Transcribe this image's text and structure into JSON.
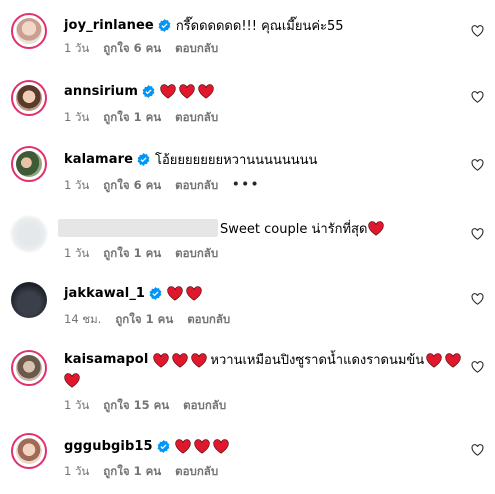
{
  "comments": [
    {
      "username": "joy_rinlanee",
      "verified": true,
      "text": "กรี๊ดดดดดด!!! คุณเมี๊ยนค่ะ55",
      "time": "1 วัน",
      "likes": "ถูกใจ 6 คน",
      "reply": "ตอบกลับ"
    },
    {
      "username": "annsirium",
      "verified": true,
      "text": "",
      "time": "1 วัน",
      "likes": "ถูกใจ 1 คน",
      "reply": "ตอบกลับ"
    },
    {
      "username": "kalamare",
      "verified": true,
      "text": "โอ้ยยยยยยยหวานนนนนนนน",
      "time": "1 วัน",
      "likes": "ถูกใจ 6 คน",
      "reply": "ตอบกลับ",
      "more": "•••"
    },
    {
      "username": "",
      "verified": false,
      "text": "Sweet couple น่ารักที่สุด",
      "time": "1 วัน",
      "likes": "ถูกใจ 1 คน",
      "reply": "ตอบกลับ"
    },
    {
      "username": "jakkawal_1",
      "verified": true,
      "text": "",
      "time": "14 ชม.",
      "likes": "ถูกใจ 1 คน",
      "reply": "ตอบกลับ"
    },
    {
      "username": "kaisamapol",
      "verified": false,
      "text": "หวานเหมือนปิงซูราดน้ำแดงราดนมข้น",
      "time": "1 วัน",
      "likes": "ถูกใจ 15 คน",
      "reply": "ตอบกลับ"
    },
    {
      "username": "gggubgib15",
      "verified": true,
      "text": "",
      "time": "1 วัน",
      "likes": "ถูกใจ 1 คน",
      "reply": "ตอบกลับ"
    }
  ],
  "icons": {
    "verified": "verified-badge-icon",
    "heart": "red-heart-emoji",
    "like": "heart-outline-icon"
  },
  "colors": {
    "verified": "#0095f6",
    "heart": "#e0182d",
    "meta": "#737373"
  }
}
